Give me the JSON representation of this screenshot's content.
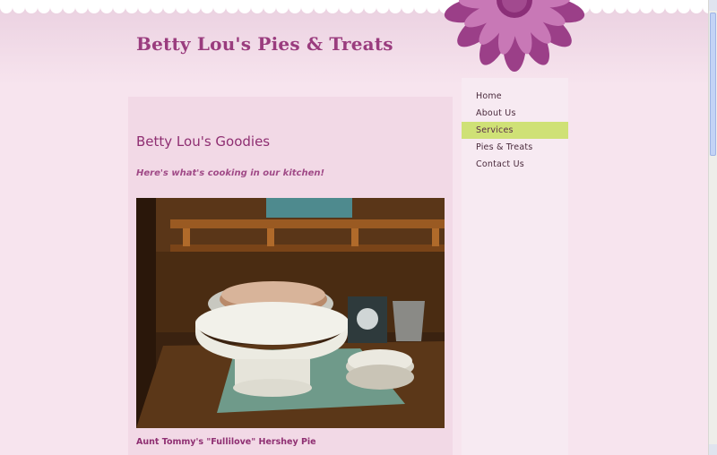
{
  "site": {
    "title": "Betty Lou's Pies & Treats"
  },
  "nav": {
    "items": [
      {
        "label": "Home"
      },
      {
        "label": "About Us"
      },
      {
        "label": "Services",
        "active": true
      },
      {
        "label": "Pies & Treats"
      },
      {
        "label": "Contact Us"
      }
    ]
  },
  "main": {
    "heading": "Betty Lou's Goodies",
    "intro": "Here's what's cooking in our kitchen!",
    "photo_caption": "Aunt Tommy's \"Fullilove\" Hershey Pie"
  },
  "colors": {
    "brand": "#9a3c7e",
    "active_nav": "#cfe176",
    "page_bg": "#f7e4ee",
    "flower": "#b0509a"
  },
  "icons": {
    "decoration": "flower-icon"
  }
}
